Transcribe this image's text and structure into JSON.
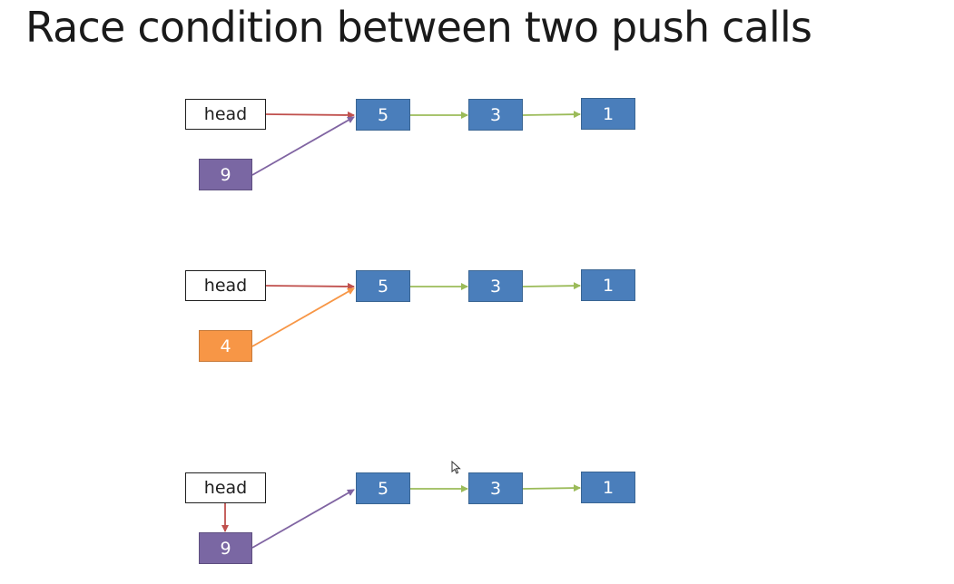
{
  "title": "Race condition between two push calls",
  "diagrams": [
    {
      "head_label": "head",
      "list_values": [
        "5",
        "3",
        "1"
      ],
      "new_node_value": "9",
      "new_node_color": "#7a67a3"
    },
    {
      "head_label": "head",
      "list_values": [
        "5",
        "3",
        "1"
      ],
      "new_node_value": "4",
      "new_node_color": "#f79646"
    },
    {
      "head_label": "head",
      "list_values": [
        "5",
        "3",
        "1"
      ],
      "new_node_value": "9",
      "new_node_color": "#7a67a3"
    }
  ],
  "colors": {
    "list_node": "#4a7ebb",
    "next_arrow": "#9bbb59",
    "head_arrow": "#c0504d"
  }
}
